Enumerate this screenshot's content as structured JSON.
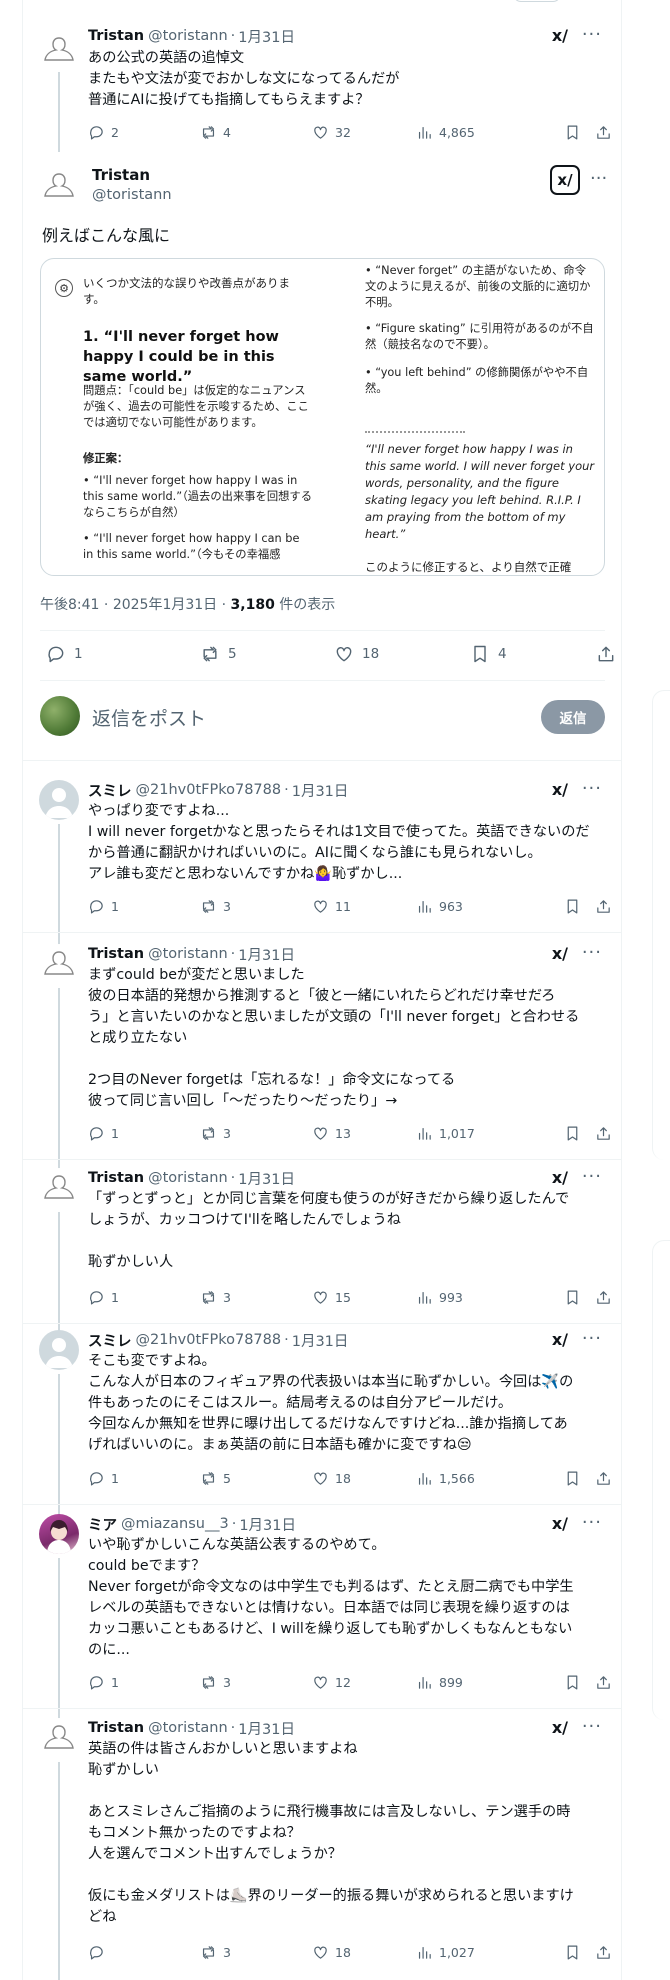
{
  "top_tweet": {
    "name": "Tristan",
    "handle": "@toristann",
    "date": "1月31日",
    "lines": [
      "あの公式の英語の追悼文",
      "またもや文法が変でおかしな文になってるんだが",
      "普通にAIに投げても指摘してもらえますよ？"
    ],
    "reply_count": "2",
    "retweet_count": "4",
    "like_count": "32",
    "view_count": "4,865"
  },
  "main_tweet": {
    "name": "Tristan",
    "handle": "@toristann",
    "grok_label": "x/",
    "text": "例えばこんな風に",
    "card": {
      "intro": "いくつか文法的な誤りや改善点があります。",
      "heading": "1. “I'll never forget how happy I could be in this same world.”",
      "problem": "問題点：「could be」は仮定的なニュアンスが強く、過去の可能性を示唆するため、ここでは適切でない可能性があります。",
      "fix_label": "修正案：",
      "fix_1": "“I'll never forget how happy I was in this same world.”（過去の出来事を回想するならこちらが自然）",
      "fix_2": "“I'll never forget how happy I can be in this same world.”（今もその幸福感",
      "right_bullets": [
        "“Never forget” の主語がないため、命令文のように見えるが、前後の文脈的に適切か不明。",
        "“Figure skating” に引用符があるのが不自然（競技名なので不要）。",
        "“you left behind” の修飾関係がやや不自然。"
      ],
      "quote": "“I'll never forget how happy I was in this same world. I will never forget your words, personality, and the figure skating legacy you left behind. R.I.P. I am praying from the bottom of my heart.”",
      "tail": "このように修正すると、より自然で正確"
    },
    "time": "午後8:41",
    "date": "2025年1月31日",
    "views": "3,180",
    "views_label": "件の表示",
    "reply_count": "1",
    "retweet_count": "5",
    "like_count": "18",
    "bookmark_count": "4"
  },
  "reply_composer": {
    "placeholder": "返信をポスト",
    "button": "返信"
  },
  "replies": [
    {
      "name": "スミレ",
      "handle": "@21hv0tFPko78788",
      "date": "1月31日",
      "lines": [
        "やっぱり変ですよね...",
        "I will never forgetかなと思ったらそれは1文目で使ってた。英語できないのだ",
        "から普通に翻訳かければいいのに。AIに聞くなら誰にも見られないし。",
        "アレ誰も変だと思わないんですかね🤷‍♀️恥ずかし..."
      ],
      "reply_count": "1",
      "retweet_count": "3",
      "like_count": "11",
      "view_count": "963"
    },
    {
      "name": "Tristan",
      "handle": "@toristann",
      "date": "1月31日",
      "lines": [
        "まずcould beが変だと思いました",
        "彼の日本語的発想から推測すると「彼と一緒にいれたらどれだけ幸せだろ",
        "う」と言いたいのかなと思いましたが文頭の「I'll never forget」と合わせる",
        "と成り立たない",
        "",
        "2つ目のNever forgetは「忘れるな！」命令文になってる",
        "彼って同じ言い回し「〜だったり〜だったり」→"
      ],
      "reply_count": "1",
      "retweet_count": "3",
      "like_count": "13",
      "view_count": "1,017"
    },
    {
      "name": "Tristan",
      "handle": "@toristann",
      "date": "1月31日",
      "lines": [
        "「ずっとずっと」とか同じ言葉を何度も使うのが好きだから繰り返したんで",
        "しょうが、カッコつけてI'llを略したんでしょうね",
        "",
        "恥ずかしい人"
      ],
      "reply_count": "1",
      "retweet_count": "3",
      "like_count": "15",
      "view_count": "993"
    },
    {
      "name": "スミレ",
      "handle": "@21hv0tFPko78788",
      "date": "1月31日",
      "lines": [
        "そこも変ですよね。",
        "こんな人が日本のフィギュア界の代表扱いは本当に恥ずかしい。今回は✈️の",
        "件もあったのにそこはスルー。結局考えるのは自分アピールだけ。",
        "今回なんか無知を世界に曝け出してるだけなんですけどね...誰か指摘してあ",
        "げればいいのに。まぁ英語の前に日本語も確かに変ですね😒"
      ],
      "reply_count": "1",
      "retweet_count": "5",
      "like_count": "18",
      "view_count": "1,566"
    },
    {
      "name": "ミア",
      "handle": "@miazansu__3",
      "date": "1月31日",
      "lines": [
        "いや恥ずかしいこんな英語公表するのやめて。",
        "could beでます？",
        "Never forgetが命令文なのは中学生でも判るはず、たとえ厨二病でも中学生",
        "レベルの英語もできないとは情けない。日本語では同じ表現を繰り返すのは",
        "カッコ悪いこともあるけど、I willを繰り返しても恥ずかしくもなんともない",
        "のに..."
      ],
      "reply_count": "1",
      "retweet_count": "3",
      "like_count": "12",
      "view_count": "899"
    },
    {
      "name": "Tristan",
      "handle": "@toristann",
      "date": "1月31日",
      "lines": [
        "英語の件は皆さんおかしいと思いますよね",
        "恥ずかしい",
        "",
        "あとスミレさんご指摘のように飛行機事故には言及しないし、テン選手の時",
        "もコメント無かったのですよね？",
        "人を選んでコメント出すんでしょうか？",
        "",
        "仮にも金メダリストは⛸️界のリーダー的振る舞いが求められると思いますけ",
        "どね"
      ],
      "reply_count": "",
      "retweet_count": "3",
      "like_count": "18",
      "view_count": "1,027"
    }
  ],
  "icons": {
    "reply": "reply-icon",
    "retweet": "retweet-icon",
    "like": "heart-icon",
    "views": "views-icon",
    "bookmark": "bookmark-icon",
    "share": "share-icon",
    "grok": "grok-icon",
    "more": "more-icon"
  },
  "colors": {
    "text": "#0f1419",
    "muted": "#536471",
    "border": "#eff3f4",
    "button": "#8b98a5"
  }
}
